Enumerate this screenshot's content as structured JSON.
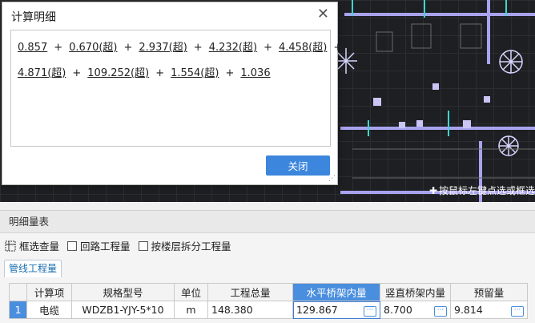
{
  "cad": {
    "hint": "按鼠标左键点选或框选"
  },
  "dialog": {
    "title": "计算明细",
    "terms": [
      "0.857",
      "0.670(超)",
      "2.937(超)",
      "4.232(超)",
      "4.458(超)",
      "4.871(超)",
      "109.252(超)",
      "1.554(超)",
      "1.036"
    ],
    "plus": "+",
    "close_label": "关闭"
  },
  "panel": {
    "title": "明细量表",
    "frame_select_label": "框选查量",
    "circuit_label": "回路工程量",
    "floor_split_label": "按楼层拆分工程量",
    "tab_label": "管线工程量"
  },
  "table": {
    "headers": [
      "",
      "计算项",
      "规格型号",
      "单位",
      "工程总量",
      "水平桥架内量",
      "竖直桥架内量",
      "预留量"
    ],
    "rows": [
      [
        "1",
        "电缆",
        "WDZB1-YJY-5*10",
        "m",
        "148.380",
        "129.867",
        "8.700",
        "9.814"
      ]
    ]
  },
  "colors": {
    "accent": "#4a8ede",
    "button": "#3c86dd"
  }
}
